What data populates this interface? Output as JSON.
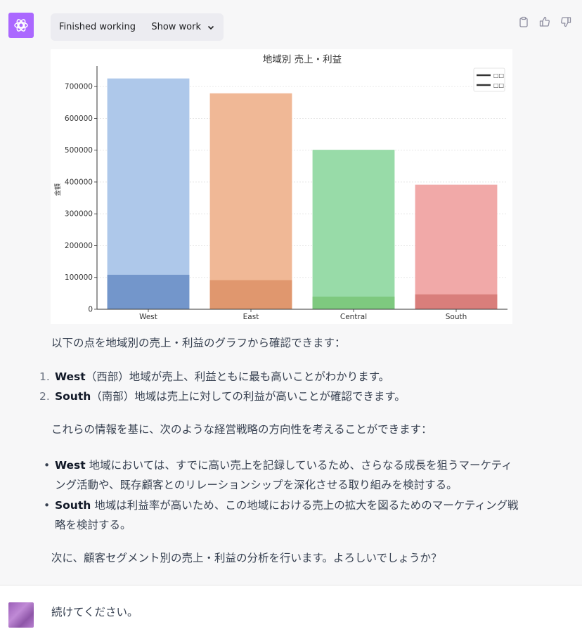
{
  "work": {
    "status": "Finished working",
    "show_label": "Show work"
  },
  "chart_data": {
    "type": "bar",
    "title": "地域別 売上・利益",
    "categories": [
      "West",
      "East",
      "Central",
      "South"
    ],
    "series": [
      {
        "name": "",
        "values": [
          725458,
          678781,
          501240,
          391722
        ],
        "colors": [
          "#aec8ea",
          "#f0b896",
          "#98dba8",
          "#f1a9a8"
        ]
      },
      {
        "name": "",
        "values": [
          108418,
          91523,
          39706,
          46750
        ],
        "colors": [
          "#7396cb",
          "#e0976e",
          "#7ec97f",
          "#d97e7b"
        ]
      }
    ],
    "ylabel": "金額",
    "xlabel": "",
    "ylim": [
      0,
      760000
    ],
    "yticks": [
      "0",
      "100000",
      "200000",
      "300000",
      "400000",
      "500000",
      "600000",
      "700000"
    ],
    "ytick_values": [
      0,
      100000,
      200000,
      300000,
      400000,
      500000,
      600000,
      700000
    ],
    "grid": true,
    "legend_placement": "top-right"
  },
  "message": {
    "intro": "以下の点を地域別の売上・利益のグラフから確認できます：",
    "points": [
      {
        "num": "1.",
        "bold": "West",
        "text": "（西部）地域が売上、利益ともに最も高いことがわかります。"
      },
      {
        "num": "2.",
        "bold": "South",
        "text": "（南部）地域は売上に対しての利益が高いことが確認できます。"
      }
    ],
    "strategy_intro": "これらの情報を基に、次のような経営戦略の方向性を考えることができます：",
    "bullets": [
      {
        "bold": "West",
        "text": " 地域においては、すでに高い売上を記録しているため、さらなる成長を狙うマーケティング活動や、既存顧客とのリレーションシップを深化させる取り組みを検討する。"
      },
      {
        "bold": "South",
        "text": " 地域は利益率が高いため、この地域における売上の拡大を図るためのマーケティング戦略を検討する。"
      }
    ],
    "closing": "次に、顧客セグメント別の売上・利益の分析を行います。よろしいでしょうか？"
  },
  "user_message": {
    "text": "続けてください。"
  },
  "icons": {
    "copy": "clipboard-icon",
    "like": "thumbs-up-icon",
    "dislike": "thumbs-down-icon",
    "chevron": "chevron-down-icon",
    "bot": "openai-logo-icon"
  }
}
